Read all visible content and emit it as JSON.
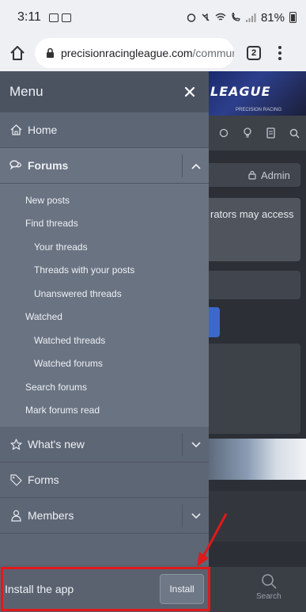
{
  "status_bar": {
    "time": "3:11",
    "battery": "81%"
  },
  "browser": {
    "url_domain": "precisionracingleague.com",
    "url_path": "/communit",
    "tab_count": "2"
  },
  "site": {
    "logo": "LEAGUE",
    "logo_sub": "PRECISION RACING",
    "admin_label": "Admin",
    "notice_text": "rators may access",
    "search_label": "Search"
  },
  "menu": {
    "title": "Menu",
    "items": [
      {
        "label": "Home",
        "icon": "home-icon"
      },
      {
        "label": "Forums",
        "icon": "comments-icon"
      },
      {
        "label": "What's new",
        "icon": "star-icon"
      },
      {
        "label": "Forms",
        "icon": "tag-icon"
      },
      {
        "label": "Members",
        "icon": "user-icon"
      }
    ],
    "forums_sub": [
      {
        "label": "New posts",
        "level": 1
      },
      {
        "label": "Find threads",
        "level": 1
      },
      {
        "label": "Your threads",
        "level": 2
      },
      {
        "label": "Threads with your posts",
        "level": 2
      },
      {
        "label": "Unanswered threads",
        "level": 2
      },
      {
        "label": "Watched",
        "level": 1
      },
      {
        "label": "Watched threads",
        "level": 2
      },
      {
        "label": "Watched forums",
        "level": 2
      },
      {
        "label": "Search forums",
        "level": 1
      },
      {
        "label": "Mark forums read",
        "level": 1
      }
    ]
  },
  "install": {
    "text": "Install the app",
    "button": "Install"
  },
  "colors": {
    "highlight": "#e0191b",
    "drawer": "#5d6675",
    "drawer_header": "#4b5361"
  }
}
